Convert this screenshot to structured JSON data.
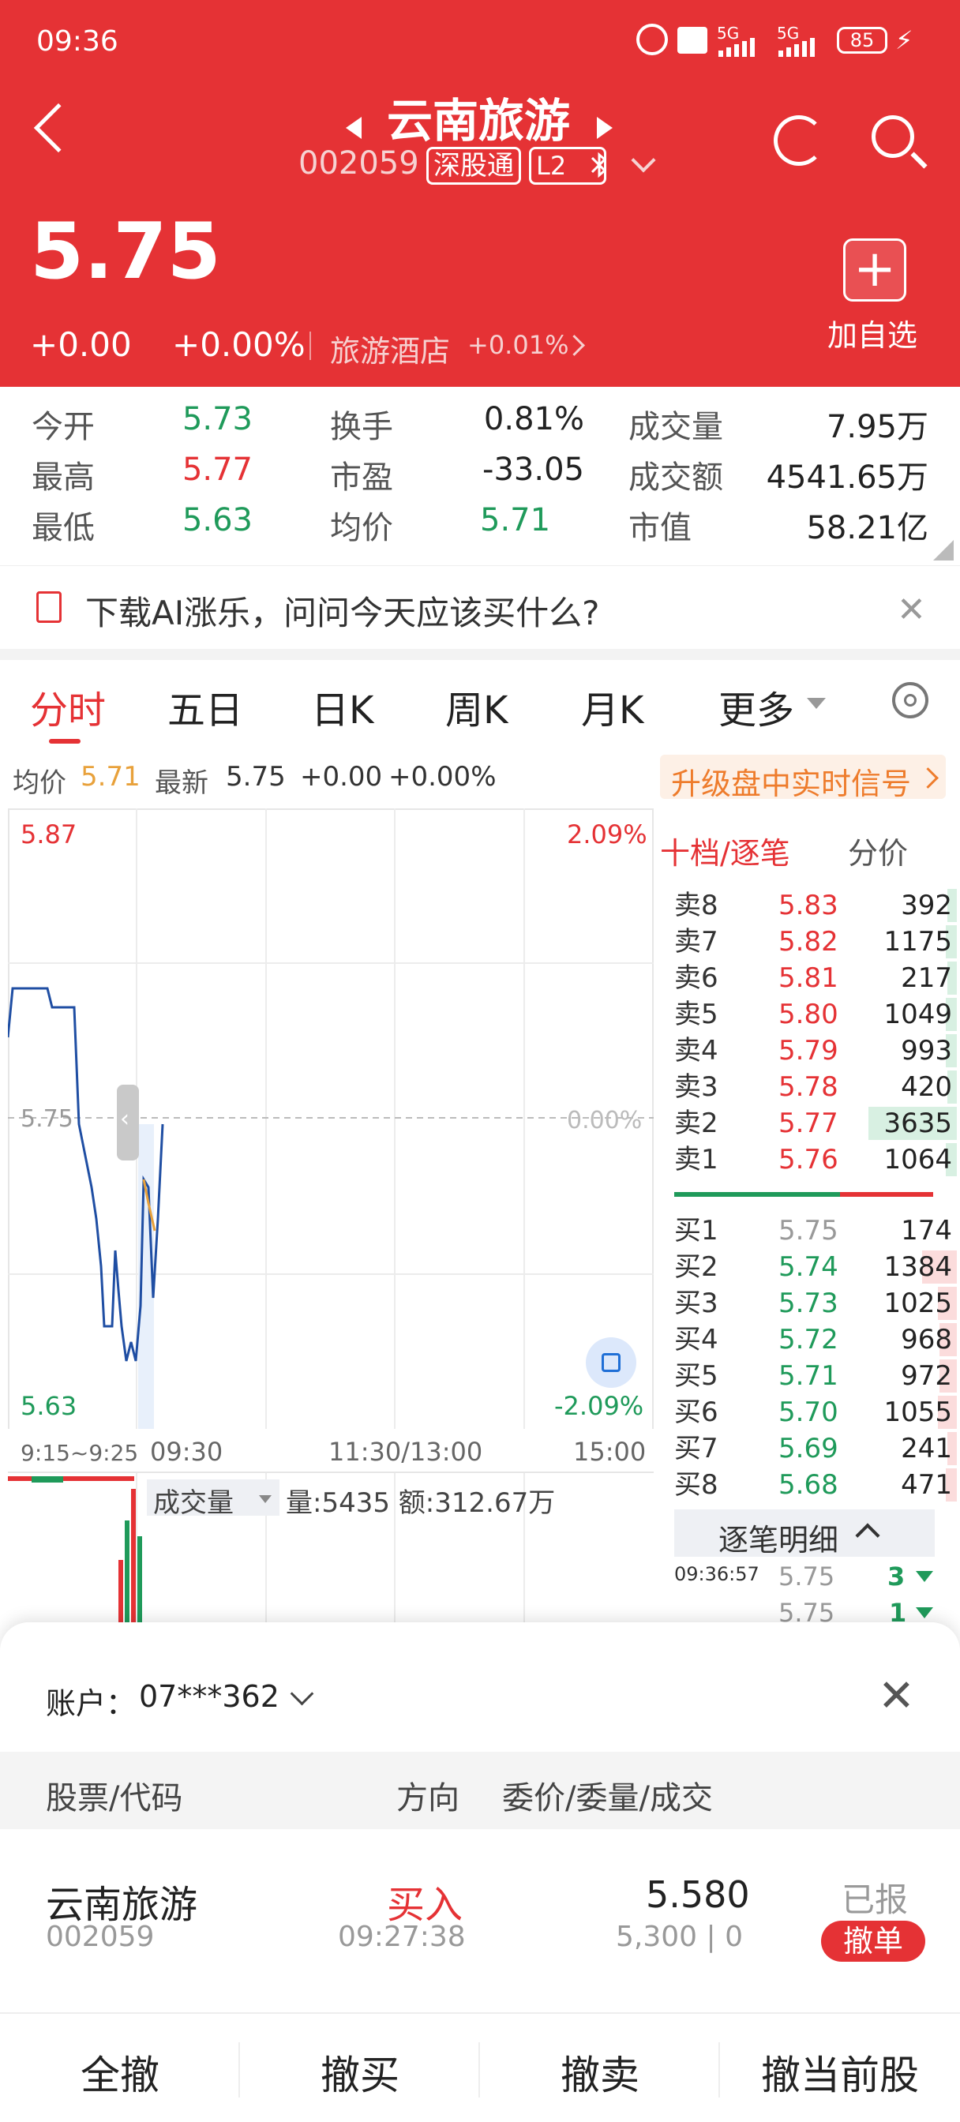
{
  "status_bar": {
    "time": "09:36",
    "battery": "85",
    "net1": "5G",
    "net2": "5G"
  },
  "header": {
    "title": "云南旅游",
    "code": "002059",
    "badge": "深股通",
    "level": "L2",
    "price": "5.75",
    "change": "+0.00",
    "change_pct": "+0.00%",
    "sector": "旅游酒店",
    "sector_pct": "+0.01%",
    "add_label": "加自选"
  },
  "stats": [
    {
      "label": "今开",
      "value": "5.73",
      "color": "green"
    },
    {
      "label": "换手",
      "value": "0.81%",
      "color": "black"
    },
    {
      "label": "成交量",
      "value": "7.95万",
      "color": "black"
    },
    {
      "label": "最高",
      "value": "5.77",
      "color": "red"
    },
    {
      "label": "市盈",
      "value": "-33.05",
      "color": "black"
    },
    {
      "label": "成交额",
      "value": "4541.65万",
      "color": "black"
    },
    {
      "label": "最低",
      "value": "5.63",
      "color": "green"
    },
    {
      "label": "均价",
      "value": "5.71",
      "color": "green"
    },
    {
      "label": "市值",
      "value": "58.21亿",
      "color": "black"
    }
  ],
  "ad": {
    "text": "下载AI涨乐，问问今天应该买什么?"
  },
  "tabs": [
    "分时",
    "五日",
    "日K",
    "周K",
    "月K",
    "更多"
  ],
  "info": {
    "avg_label": "均价",
    "avg": "5.71",
    "latest_label": "最新",
    "latest": "5.75",
    "chg": "+0.00",
    "chg_pct": "+0.00%",
    "upgrade": "升级盘中实时信号"
  },
  "chart": {
    "ymax": "5.87",
    "ymid": "5.75",
    "ymin": "5.63",
    "pmax": "2.09%",
    "pmid": "0.00%",
    "pmin": "-2.09%",
    "t1": "9:15~9:25",
    "t2": "09:30",
    "t3": "11:30/13:00",
    "t4": "15:00",
    "vol_label": "成交量",
    "vol_text": "量:5435 额:312.67万"
  },
  "orderbook": {
    "tab1": "十档/逐笔",
    "tab2": "分价",
    "sells": [
      {
        "l": "卖8",
        "p": "5.83",
        "q": "392"
      },
      {
        "l": "卖7",
        "p": "5.82",
        "q": "1175"
      },
      {
        "l": "卖6",
        "p": "5.81",
        "q": "217"
      },
      {
        "l": "卖5",
        "p": "5.80",
        "q": "1049"
      },
      {
        "l": "卖4",
        "p": "5.79",
        "q": "993"
      },
      {
        "l": "卖3",
        "p": "5.78",
        "q": "420"
      },
      {
        "l": "卖2",
        "p": "5.77",
        "q": "3635"
      },
      {
        "l": "卖1",
        "p": "5.76",
        "q": "1064"
      }
    ],
    "buys": [
      {
        "l": "买1",
        "p": "5.75",
        "q": "174"
      },
      {
        "l": "买2",
        "p": "5.74",
        "q": "1384"
      },
      {
        "l": "买3",
        "p": "5.73",
        "q": "1025"
      },
      {
        "l": "买4",
        "p": "5.72",
        "q": "968"
      },
      {
        "l": "买5",
        "p": "5.71",
        "q": "972"
      },
      {
        "l": "买6",
        "p": "5.70",
        "q": "1055"
      },
      {
        "l": "买7",
        "p": "5.69",
        "q": "241"
      },
      {
        "l": "买8",
        "p": "5.68",
        "q": "471"
      }
    ],
    "detail_label": "逐笔明细",
    "ticks": [
      {
        "t": "09:36:57",
        "p": "5.75",
        "q": "3"
      },
      {
        "t": "",
        "p": "5.75",
        "q": "1"
      }
    ]
  },
  "sheet": {
    "account_label": "账户：",
    "account": "07***362",
    "col1": "股票/代码",
    "col2": "方向",
    "col3": "委价/委量/成交",
    "order": {
      "name": "云南旅游",
      "code": "002059",
      "dir": "买入",
      "time": "09:27:38",
      "price": "5.580",
      "qty": "5,300 | 0",
      "status": "已报",
      "cancel": "撤单"
    },
    "buttons": [
      "全撤",
      "撤买",
      "撤卖",
      "撤当前股"
    ]
  }
}
